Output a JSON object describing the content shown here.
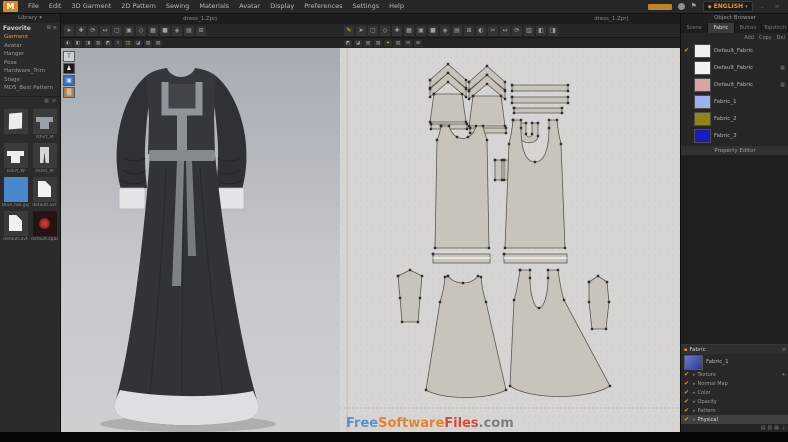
{
  "app": {
    "logo": "M",
    "menu": [
      "File",
      "Edit",
      "3D Garment",
      "2D Pattern",
      "Sewing",
      "Materials",
      "Avatar",
      "Display",
      "Preferences",
      "Settings",
      "Help"
    ],
    "language": "ENGLISH",
    "lang_caret": "▾",
    "window_controls": [
      "–",
      "✕"
    ]
  },
  "viewport_tabs": {
    "view3d": "dress_1.Zprj",
    "view2d": "dress_1.Zprj"
  },
  "library": {
    "tab": "Library",
    "tab_caret": "▾",
    "title": "Favorite",
    "header_icons": [
      {
        "g": "⊞"
      },
      {
        "g": "≡"
      }
    ],
    "items": [
      {
        "label": "Garment",
        "active": true
      },
      {
        "label": "Avatar"
      },
      {
        "label": "Hanger"
      },
      {
        "label": "Pose"
      },
      {
        "label": "Hardware_Trim"
      },
      {
        "label": "Stage"
      },
      {
        "label": "MD5_Best Pattern"
      }
    ],
    "view_icons": [
      {
        "g": "▦"
      },
      {
        "g": "≡"
      }
    ],
    "thumbnails": [
      {
        "caption": "",
        "kind": "folder"
      },
      {
        "caption": "Tshirt_M",
        "kind": "tshirt"
      },
      {
        "caption": "Tshirt_W",
        "kind": "tshirt light"
      },
      {
        "caption": "Pants_M",
        "kind": "pants"
      },
      {
        "caption": "Blue_fab.jpg",
        "kind": "swatch-blue"
      },
      {
        "caption": "default.avt",
        "kind": "doc"
      },
      {
        "caption": "default.avt",
        "kind": "doc"
      },
      {
        "caption": "default.zpac",
        "kind": "texture-red"
      }
    ]
  },
  "toolbar3d": {
    "row1": [
      {
        "g": "➤"
      },
      {
        "g": "✚"
      },
      {
        "g": "⟳"
      },
      {
        "g": "↔"
      },
      {
        "g": "▢"
      },
      {
        "g": "▣"
      },
      {
        "g": "◇"
      },
      {
        "g": "▦"
      },
      {
        "g": "■"
      },
      {
        "g": "◈"
      },
      {
        "g": "▤"
      },
      {
        "g": "⊞"
      }
    ],
    "row2": [
      {
        "g": "◐"
      },
      {
        "g": "◧"
      },
      {
        "g": "◨"
      },
      {
        "g": "▥"
      },
      {
        "g": "◩"
      },
      {
        "g": "↕"
      },
      {
        "g": "◫",
        "a": 1
      },
      {
        "g": "◪"
      },
      {
        "g": "▧"
      },
      {
        "g": "▨"
      }
    ]
  },
  "toolbar2d": {
    "row1": [
      {
        "g": "✎",
        "a": 1
      },
      {
        "g": "➤"
      },
      {
        "g": "▢"
      },
      {
        "g": "◇"
      },
      {
        "g": "✚"
      },
      {
        "g": "▦"
      },
      {
        "g": "▣"
      },
      {
        "g": "■"
      },
      {
        "g": "◈"
      },
      {
        "g": "▤"
      },
      {
        "g": "⊞"
      },
      {
        "g": "◐"
      },
      {
        "g": "✂"
      },
      {
        "g": "↔"
      },
      {
        "g": "⟳"
      },
      {
        "g": "▥"
      },
      {
        "g": "◧"
      },
      {
        "g": "◨"
      }
    ],
    "row2": [
      {
        "g": "◩"
      },
      {
        "g": "◪"
      },
      {
        "g": "▧"
      },
      {
        "g": "▨"
      },
      {
        "g": "✦",
        "a": 1
      },
      {
        "g": "▤"
      },
      {
        "g": "⊟"
      },
      {
        "g": "⊞"
      }
    ]
  },
  "view_toggles": [
    {
      "name": "garment-toggle",
      "g": "T",
      "cls": "tg-garment"
    },
    {
      "name": "avatar-toggle",
      "g": "♟",
      "cls": "tg-avatar"
    },
    {
      "name": "blue-toggle",
      "g": "▣",
      "cls": "tg-blue"
    },
    {
      "name": "tan-toggle",
      "g": "▒",
      "cls": "tg-tan"
    }
  ],
  "object_browser": {
    "title": "Object Browser",
    "tabs": [
      {
        "label": "Scene"
      },
      {
        "label": "Fabric",
        "active": true
      },
      {
        "label": "Button"
      },
      {
        "label": "Topstitch"
      }
    ],
    "actions": [
      "Add",
      "Copy",
      "Del"
    ],
    "fabrics": [
      {
        "name": "Default_Fabric",
        "color": "#eef0ef",
        "checked": true
      },
      {
        "name": "Default_Fabric",
        "color": "#f2f2f0",
        "locked": true
      },
      {
        "name": "Default_Fabric",
        "color": "#d6a5a4",
        "locked": true
      },
      {
        "name": "Fabric_1",
        "color": "#9fb0ee"
      },
      {
        "name": "Fabric_2",
        "color": "#8f8415"
      },
      {
        "name": "Fabric_3",
        "color": "#1b1bbd"
      }
    ],
    "property_editor_title": "Property Editor"
  },
  "property_panel": {
    "header": "Fabric",
    "item_name": "Fabric_1",
    "rows": [
      {
        "label": "Texture",
        "plus": "+"
      },
      {
        "label": "Normal Map"
      },
      {
        "label": "Color"
      },
      {
        "label": "Opacity"
      },
      {
        "label": "Pattern"
      },
      {
        "label": "Physical",
        "selected": true
      }
    ],
    "footer_icons": [
      {
        "g": "▤"
      },
      {
        "g": "▥"
      },
      {
        "g": "▦"
      },
      {
        "g": "＋"
      }
    ]
  },
  "pattern_pieces": [
    "sleeve-stack-left",
    "sleeve-stack-right",
    "waistband-1",
    "waistband-2",
    "waistband-3",
    "neck-facing",
    "bodice-front",
    "bodice-front-hem",
    "cuff-1",
    "cuff-2",
    "bodice-back",
    "bodice-back-hem",
    "sleeve-small-left",
    "skirt-front",
    "skirt-back",
    "sleeve-small-right"
  ],
  "watermark": {
    "parts": [
      {
        "text": "Free",
        "color": "#5b8dd6"
      },
      {
        "text": "Software",
        "color": "#e2812f"
      },
      {
        "text": "Files",
        "color": "#d94a35"
      },
      {
        "text": ".com",
        "color": "#7d7d7d"
      }
    ]
  }
}
